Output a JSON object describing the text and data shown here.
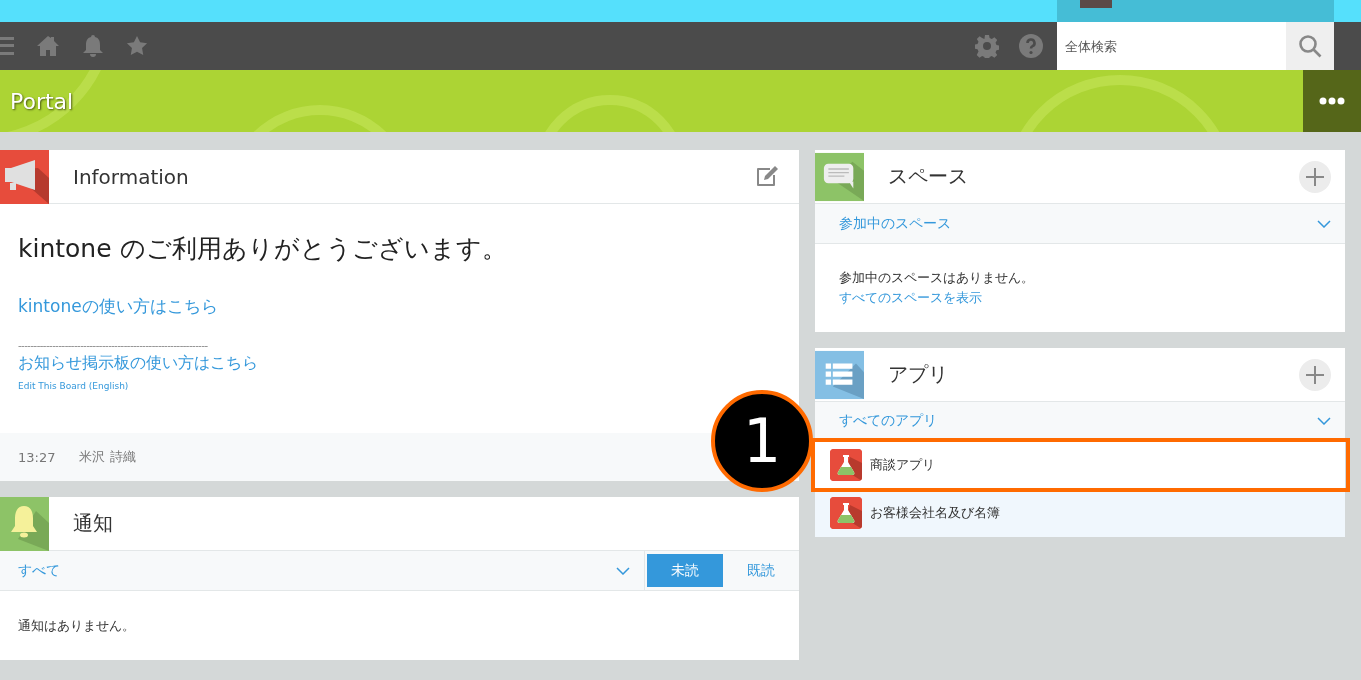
{
  "search": {
    "placeholder": "全体検索"
  },
  "header": {
    "title": "Portal"
  },
  "information": {
    "title": "Information",
    "headline": "kintone のご利用ありがとうございます。",
    "link": "kintoneの使い方はこちら",
    "separator": "-------------------------------------------------------------",
    "board_link": "お知らせ掲示板の使い方はこちら",
    "english_link": "Edit This Board (English)",
    "time": "13:27",
    "author": "米沢 詩織"
  },
  "notifications": {
    "title": "通知",
    "filter": "すべて",
    "tabs": [
      {
        "label": "未読",
        "selected": true
      },
      {
        "label": "既読",
        "selected": false
      }
    ],
    "empty": "通知はありません。"
  },
  "spaces": {
    "title": "スペース",
    "filter": "参加中のスペース",
    "empty": "参加中のスペースはありません。",
    "show_all": "すべてのスペースを表示"
  },
  "apps": {
    "title": "アプリ",
    "filter": "すべてのアプリ",
    "items": [
      {
        "name": "商談アプリ",
        "highlighted": true
      },
      {
        "name": "お客様会社名及び名簿",
        "highlighted": false
      }
    ]
  },
  "callout": {
    "label": "1"
  }
}
